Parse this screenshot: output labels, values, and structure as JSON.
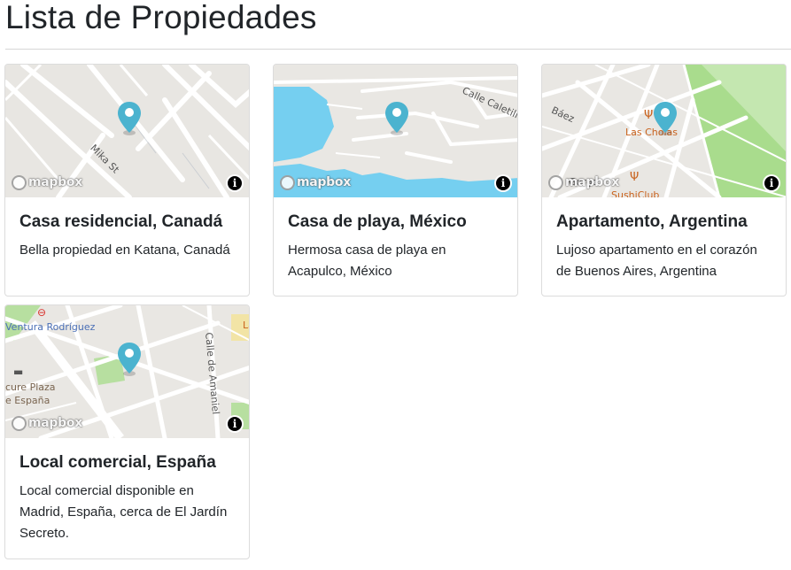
{
  "page": {
    "title": "Lista de Propiedades"
  },
  "map_common": {
    "logo_text": "mapbox",
    "info_glyph": "i",
    "pin_color": "#4bb3cf"
  },
  "properties": [
    {
      "title": "Casa residencial, Canadá",
      "description": "Bella propiedad en Katana, Canadá",
      "map_labels": [
        "Mika St"
      ]
    },
    {
      "title": "Casa de playa, México",
      "description": "Hermosa casa de playa en Acapulco, México",
      "map_labels": [
        "Calle Caletilla"
      ]
    },
    {
      "title": "Apartamento, Argentina",
      "description": "Lujoso apartamento en el corazón de Buenos Aires, Argentina",
      "map_labels": [
        "Báez",
        "Las Cholas",
        "SushiClub",
        "Gorgo"
      ]
    },
    {
      "title": "Local comercial, España",
      "description": "Local comercial disponible en Madrid, España, cerca de El Jardín Secreto.",
      "map_labels": [
        "Ventura Rodríguez",
        "cure Plaza",
        "e España",
        "Calle de Amaniel",
        "La"
      ]
    }
  ]
}
